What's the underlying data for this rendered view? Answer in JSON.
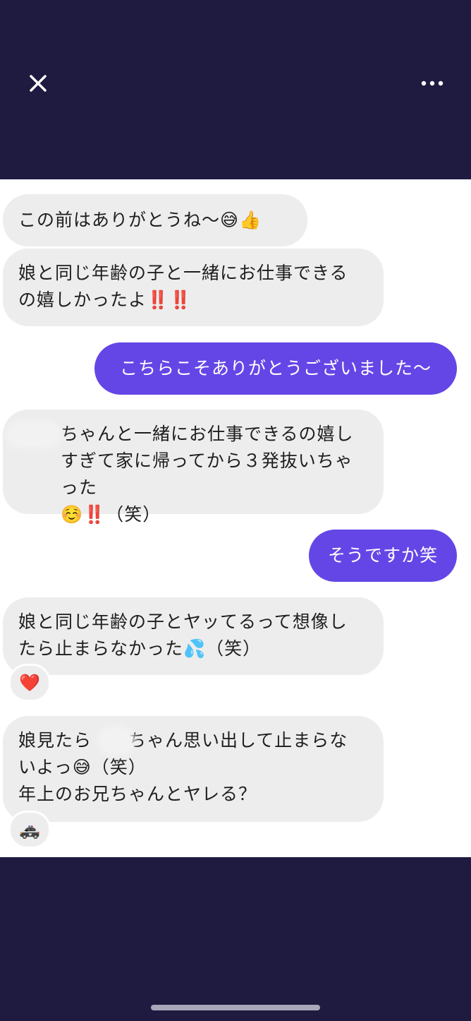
{
  "header": {
    "close_icon": "close-icon",
    "more_icon": "more-horizontal-icon"
  },
  "messages": [
    {
      "side": "received",
      "text": "この前はありがとうね〜😅👍"
    },
    {
      "side": "received",
      "text": "娘と同じ年齢の子と一緒にお仕事できる\nの嬉しかったよ‼️‼️"
    },
    {
      "side": "sent",
      "text": "こちらこそありがとうございました〜"
    },
    {
      "side": "received",
      "text": "ちゃんと一緒にお仕事できるの嬉し\nすぎて家に帰ってから３発抜いちゃった\n☺️‼️（笑）"
    },
    {
      "side": "sent",
      "text": "そうですか笑"
    },
    {
      "side": "received",
      "text": "娘と同じ年齢の子とヤッてるって想像し\nたら止まらなかった💦（笑）",
      "reaction": "❤️"
    },
    {
      "side": "received",
      "text": "娘見たら　　ちゃん思い出して止まらな\nいよっ😅（笑）\n年上のお兄ちゃんとヤレる？",
      "reaction": "🚓"
    }
  ],
  "colors": {
    "background": "#1f1a40",
    "chat_background": "#ffffff",
    "received_bubble": "#ededed",
    "sent_bubble": "#6446e6"
  }
}
